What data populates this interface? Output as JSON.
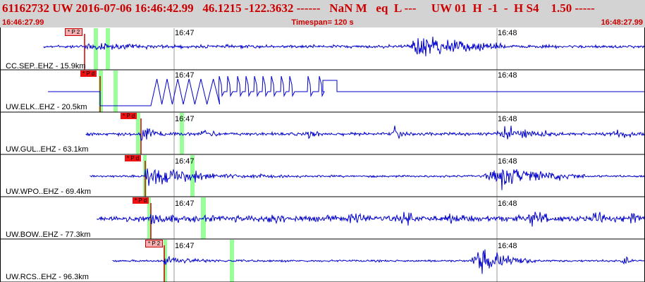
{
  "header": {
    "event_line": "61162732 UW 2016-07-06 16:46:42.99   46.1215 -122.3632 ------   NaN M   eq  L ---     UW 01  H  -1  -  H S4    1.50 -----"
  },
  "timebar": {
    "start": "16:46:27.99",
    "timespan": "Timespan= 120 s",
    "end": "16:48:27.99"
  },
  "colors": {
    "trace": "#0000cc",
    "header_text": "#cc0000",
    "header_bg": "#d3d3d3",
    "pick_red": "#ee1111",
    "pick_pink": "#f4b0b0",
    "window_green": "#99ff99"
  },
  "minute_labels": [
    "16:47",
    "16:48"
  ],
  "traces": [
    {
      "label": "CC.SEP..EHZ - 15.9km",
      "pick": "* P 2",
      "pick_style": "pink"
    },
    {
      "label": "UW.ELK..EHZ - 20.5km",
      "pick": "* P d",
      "pick_style": "red"
    },
    {
      "label": "UW.GUL..EHZ - 63.1km",
      "pick": "* P d",
      "pick_style": "red"
    },
    {
      "label": "UW.WPO..EHZ - 69.4km",
      "pick": "* P d",
      "pick_style": "red"
    },
    {
      "label": "UW.BOW..EHZ - 77.3km",
      "pick": "* P d",
      "pick_style": "red"
    },
    {
      "label": "UW.RCS..EHZ - 96.3km",
      "pick": "* P 2",
      "pick_style": "pink"
    }
  ]
}
